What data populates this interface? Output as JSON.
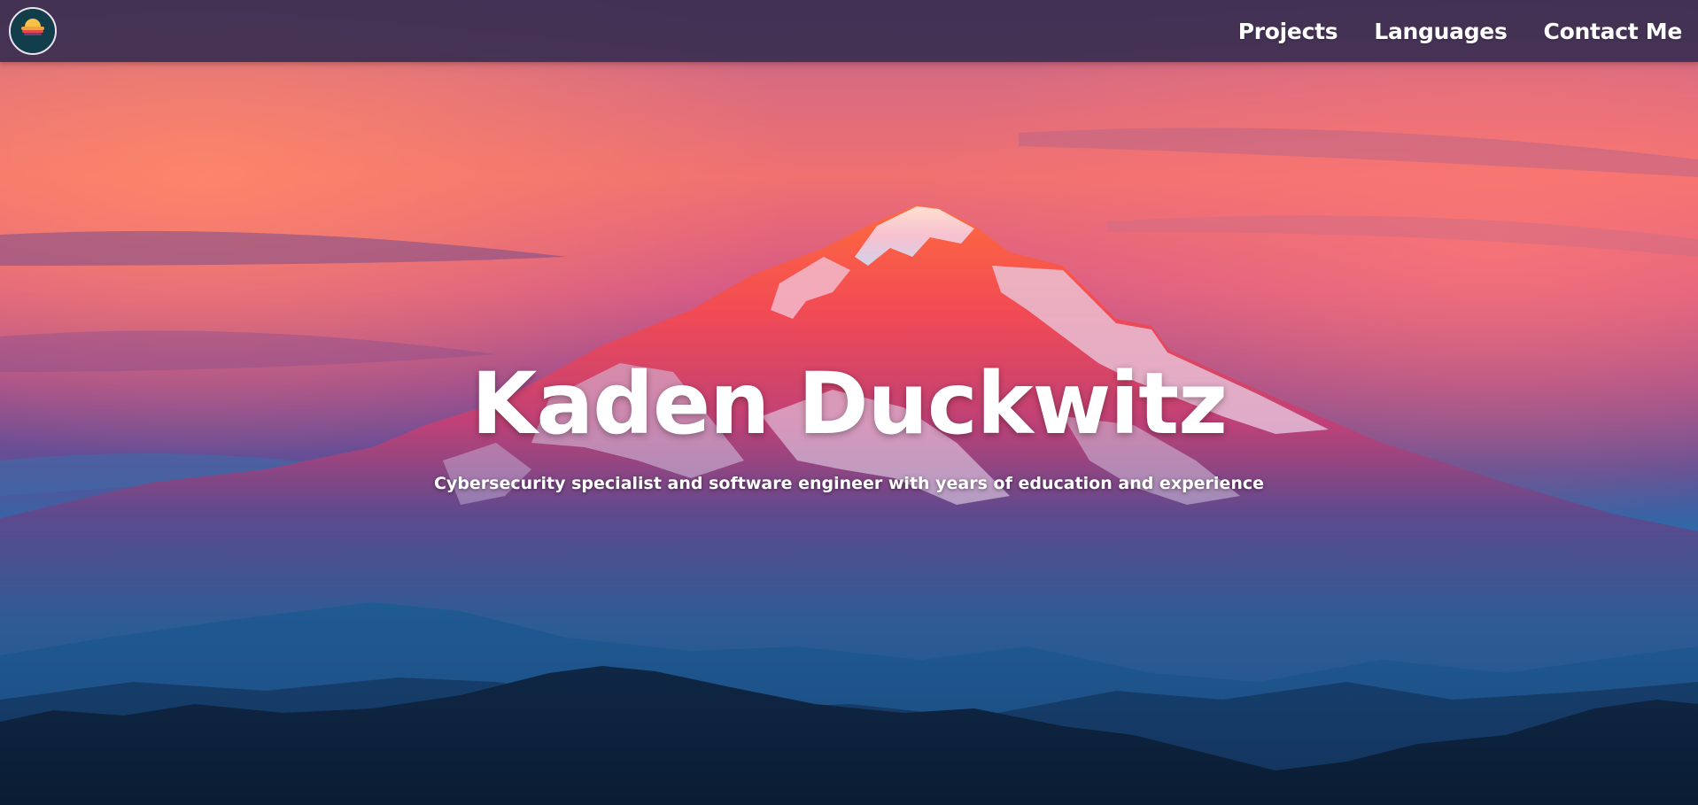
{
  "colors": {
    "navbar_bg": "#3a2e52",
    "sky_top": "#b35a8a",
    "sky_glow": "#f26d6d",
    "mountain_peak": "#ff5a4a",
    "valley_blue": "#1f5b93",
    "forest_dark": "#0e2440",
    "text": "#ffffff"
  },
  "navbar": {
    "logo_icon": "sunset-logo-icon",
    "links": [
      "Projects",
      "Languages",
      "Contact Me"
    ]
  },
  "hero": {
    "title": "Kaden Duckwitz",
    "subtitle": "Cybersecurity specialist and software engineer with years of education and experience",
    "background": "mountain-sunset-image"
  }
}
